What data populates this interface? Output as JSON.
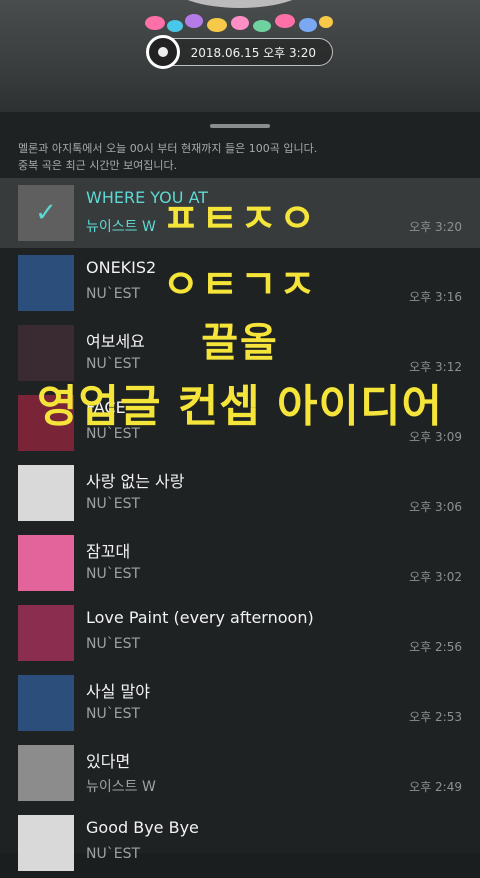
{
  "header": {
    "timestamp": "2018.06.15 오후 3:20"
  },
  "notice": {
    "line1": "멜론과 아지톡에서 오늘 00시 부터 현재까지 들은 100곡 입니다.",
    "line2": "중복 곡은 최근 시간만 보여집니다."
  },
  "songs": [
    {
      "title": "WHERE YOU AT",
      "artist": "뉴이스트 W",
      "time": "오후 3:20",
      "art": "#6c6c6c",
      "selected": true
    },
    {
      "title": "ONEKIS2",
      "artist": "NU`EST",
      "time": "오후 3:16",
      "art": "#2b4f7a"
    },
    {
      "title": "여보세요",
      "artist": "NU`EST",
      "time": "오후 3:12",
      "art": "#3a2b33"
    },
    {
      "title": "FACE",
      "artist": "NU`EST",
      "time": "오후 3:09",
      "art": "#7a2438"
    },
    {
      "title": "사랑 없는 사랑",
      "artist": "NU`EST",
      "time": "오후 3:06",
      "art": "#d9d9d9"
    },
    {
      "title": "잠꼬대",
      "artist": "NU`EST",
      "time": "오후 3:02",
      "art": "#e2649a"
    },
    {
      "title": "Love Paint (every afternoon)",
      "artist": "NU`EST",
      "time": "오후 2:56",
      "art": "#8a2d4e"
    },
    {
      "title": "사실 말야",
      "artist": "NU`EST",
      "time": "오후 2:53",
      "art": "#2b4f7a"
    },
    {
      "title": "있다면",
      "artist": "뉴이스트 W",
      "time": "오후 2:49",
      "art": "#8c8c8c"
    },
    {
      "title": "Good Bye Bye",
      "artist": "NU`EST",
      "time": "",
      "art": "#d9d9d9"
    }
  ],
  "overlay": {
    "line1": "ㅍㅌㅈㅇ",
    "line2": "ㅇㅌㄱㅈ",
    "line3": "끌올",
    "line4": "영업글 컨셉 아이디어"
  },
  "colors": {
    "accent": "#5ed8d2",
    "overlay_text": "#f5e43a",
    "panel_bg": "#1f2223"
  }
}
